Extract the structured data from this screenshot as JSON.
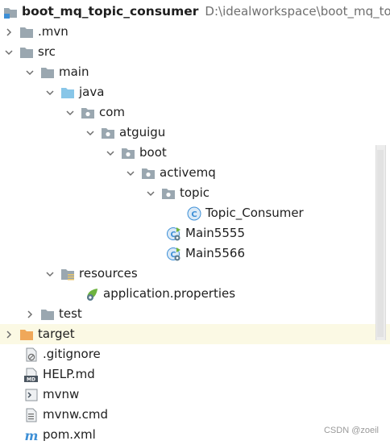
{
  "project": {
    "name": "boot_mq_topic_consumer",
    "path": "D:\\idealworkspace\\boot_mq_topic_consumer"
  },
  "tree": [
    {
      "label": ".mvn",
      "icon": "folder-icon",
      "expanded": false
    },
    {
      "label": "src",
      "icon": "folder-icon",
      "expanded": true
    },
    {
      "label": "main",
      "icon": "folder-icon",
      "expanded": true
    },
    {
      "label": "java",
      "icon": "source-folder-icon",
      "expanded": true
    },
    {
      "label": "com",
      "icon": "package-icon",
      "expanded": true
    },
    {
      "label": "atguigu",
      "icon": "package-icon",
      "expanded": true
    },
    {
      "label": "boot",
      "icon": "package-icon",
      "expanded": true
    },
    {
      "label": "activemq",
      "icon": "package-icon",
      "expanded": true
    },
    {
      "label": "topic",
      "icon": "package-icon",
      "expanded": true
    },
    {
      "label": "Topic_Consumer",
      "icon": "class-icon"
    },
    {
      "label": "Main5555",
      "icon": "spring-boot-class-icon"
    },
    {
      "label": "Main5566",
      "icon": "spring-boot-class-icon"
    },
    {
      "label": "resources",
      "icon": "resources-folder-icon",
      "expanded": true
    },
    {
      "label": "application.properties",
      "icon": "spring-properties-icon"
    },
    {
      "label": "test",
      "icon": "folder-icon",
      "expanded": false
    },
    {
      "label": "target",
      "icon": "excluded-folder-icon",
      "expanded": false
    },
    {
      "label": ".gitignore",
      "icon": "gitignore-file-icon"
    },
    {
      "label": "HELP.md",
      "icon": "markdown-file-icon"
    },
    {
      "label": "mvnw",
      "icon": "shell-script-icon"
    },
    {
      "label": "mvnw.cmd",
      "icon": "text-file-icon"
    },
    {
      "label": "pom.xml",
      "icon": "maven-icon"
    }
  ],
  "watermark": "CSDN @zoeil",
  "colors": {
    "folder": "#9aa7b0",
    "source_folder": "#88c6e8",
    "excluded_folder": "#f0a85a",
    "class": "#3d8fd6",
    "spring": "#6db33f",
    "highlight_row": "#fbf9e4"
  }
}
